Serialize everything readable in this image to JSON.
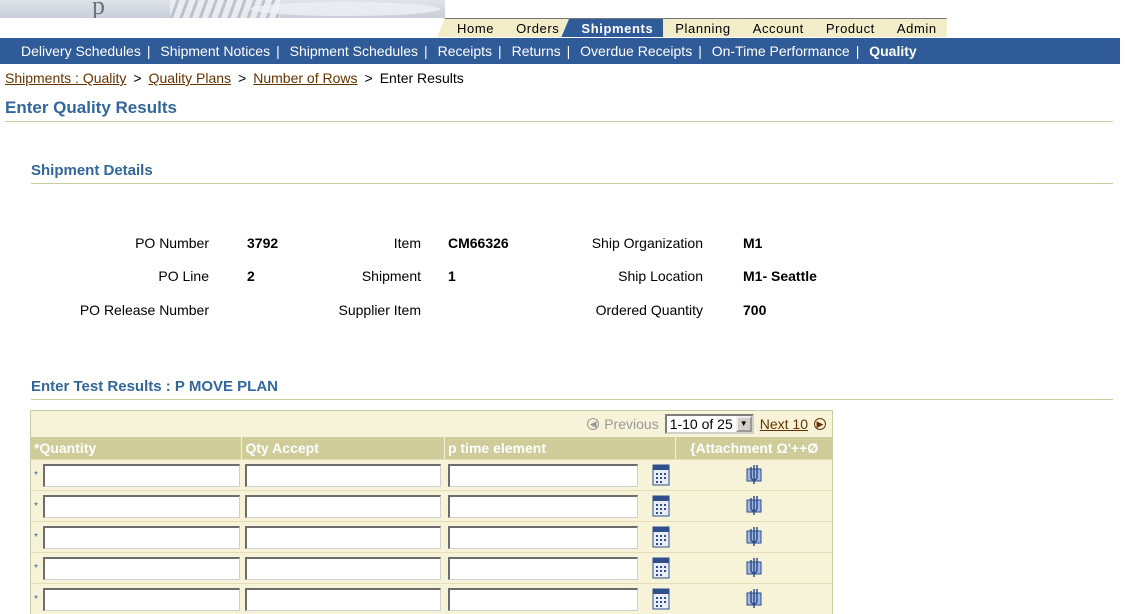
{
  "tabs": [
    "Home",
    "Orders",
    "Shipments",
    "Planning",
    "Account",
    "Product",
    "Admin"
  ],
  "active_tab": "Shipments",
  "subnav": {
    "items": [
      "Delivery Schedules",
      "Shipment Notices",
      "Shipment Schedules",
      "Receipts",
      "Returns",
      "Overdue Receipts",
      "On-Time Performance",
      "Quality"
    ],
    "current": "Quality"
  },
  "breadcrumb": {
    "links": [
      "Shipments : Quality",
      "Quality Plans",
      "Number of Rows"
    ],
    "current": "Enter Results"
  },
  "page_title": "Enter Quality Results",
  "shipment_details": {
    "title": "Shipment Details",
    "po_number_label": "PO Number",
    "po_number": "3792",
    "po_line_label": "PO Line",
    "po_line": "2",
    "po_release_label": "PO Release Number",
    "po_release": "",
    "item_label": "Item",
    "item": "CM66326",
    "shipment_label": "Shipment",
    "shipment": "1",
    "supplier_item_label": "Supplier Item",
    "supplier_item": "",
    "ship_org_label": "Ship Organization",
    "ship_org": "M1",
    "ship_location_label": "Ship Location",
    "ship_location": "M1- Seattle",
    "ordered_qty_label": "Ordered Quantity",
    "ordered_qty": "700"
  },
  "test_results": {
    "title": "Enter Test Results : P MOVE PLAN",
    "pager": {
      "previous": "Previous",
      "range": "1-10 of 25",
      "next": "Next 10"
    },
    "columns": [
      "*Quantity",
      "Qty Accept",
      "p time element",
      "{Attachment Ω'++Ø"
    ],
    "required_marker": "*",
    "rows": [
      {
        "quantity": "",
        "qty_accept": "",
        "p_time_element": ""
      },
      {
        "quantity": "",
        "qty_accept": "",
        "p_time_element": ""
      },
      {
        "quantity": "",
        "qty_accept": "",
        "p_time_element": ""
      },
      {
        "quantity": "",
        "qty_accept": "",
        "p_time_element": ""
      },
      {
        "quantity": "",
        "qty_accept": "",
        "p_time_element": ""
      }
    ]
  },
  "colors": {
    "brand_blue": "#2f5b98",
    "tab_inactive": "#f2ecc8",
    "title_blue": "#336699",
    "link_brown": "#663300",
    "table_header": "#cfcc9a",
    "table_bg": "#f6f3d9"
  },
  "icons": [
    "calendar-icon",
    "paperclip-icon",
    "previous-arrow-icon",
    "next-arrow-icon",
    "dropdown-arrow-icon"
  ]
}
